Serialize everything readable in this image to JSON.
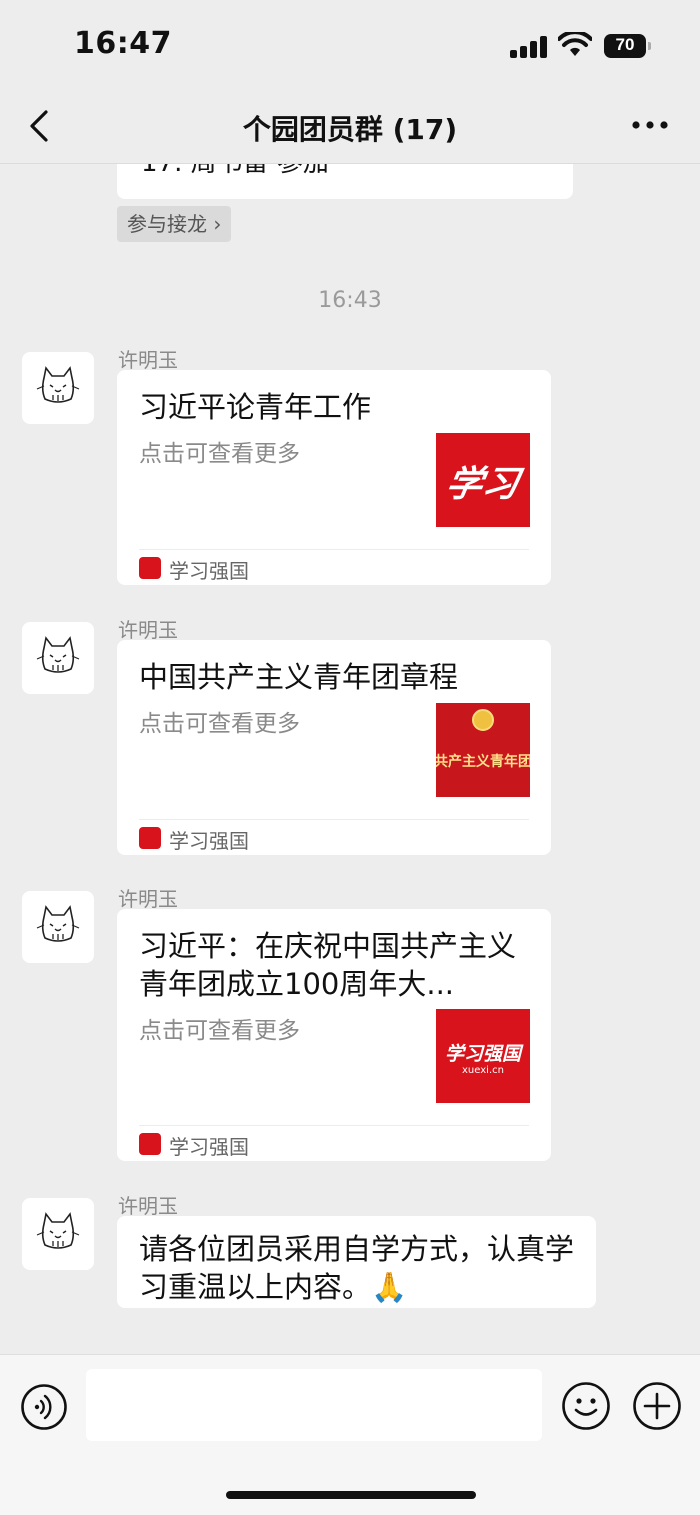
{
  "status_bar": {
    "time": "16:47",
    "battery": "70"
  },
  "nav": {
    "title": "个园团员群 (17)"
  },
  "chat": {
    "partial_message": "17. 周书雷 参加",
    "join_chip": "参与接龙 ›",
    "timestamp": "16:43",
    "messages": [
      {
        "sender": "许明玉",
        "card": {
          "title": "习近平论青年工作",
          "description": "点击可查看更多",
          "thumb_text": "学习",
          "source": "学习强国"
        }
      },
      {
        "sender": "许明玉",
        "card": {
          "title": "中国共产主义青年团章程",
          "description": "点击可查看更多",
          "thumb_text": "共产主义青年团",
          "source": "学习强国"
        }
      },
      {
        "sender": "许明玉",
        "card": {
          "title": "习近平：在庆祝中国共产主义青年团成立100周年大...",
          "description": "点击可查看更多",
          "thumb_text": "学习强国",
          "thumb_sub": "xuexi.cn",
          "source": "学习强国"
        }
      },
      {
        "sender": "许明玉",
        "text": "请各位团员采用自学方式，认真学习重温以上内容。🙏"
      }
    ]
  },
  "input_bar": {
    "placeholder": ""
  },
  "colors": {
    "brand_red": "#d8131b",
    "background": "#ededed",
    "bubble": "#ffffff"
  }
}
